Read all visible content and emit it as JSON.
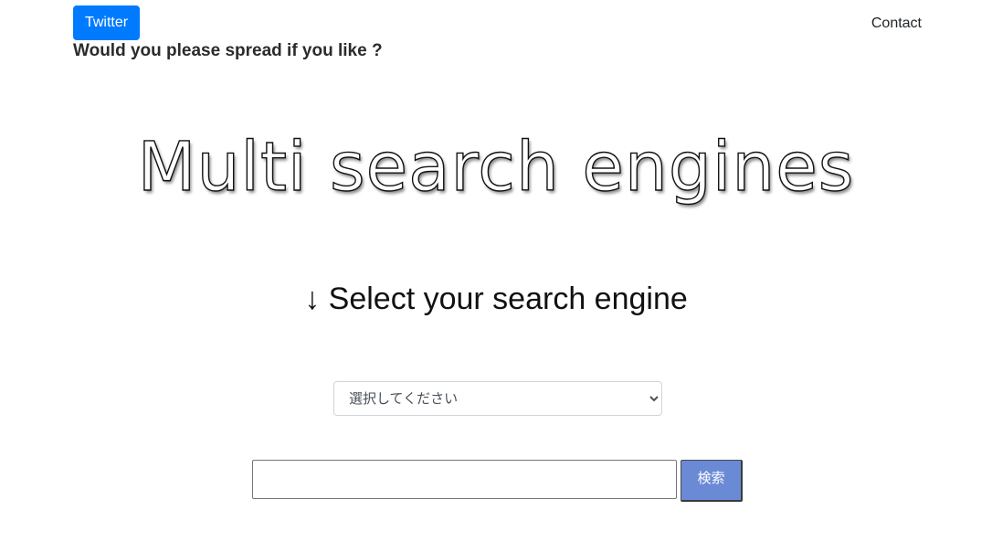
{
  "header": {
    "twitter_label": "Twitter",
    "contact_label": "Contact",
    "tagline": "Would you please spread if you like ?"
  },
  "hero": {
    "title": "Multi search engines"
  },
  "selector": {
    "heading": "↓ Select your search engine",
    "selected_option": "選択してください"
  },
  "search": {
    "query_value": "",
    "button_label": "検索"
  },
  "colors": {
    "twitter_button": "#007bff",
    "search_button": "#6b8ad6"
  }
}
